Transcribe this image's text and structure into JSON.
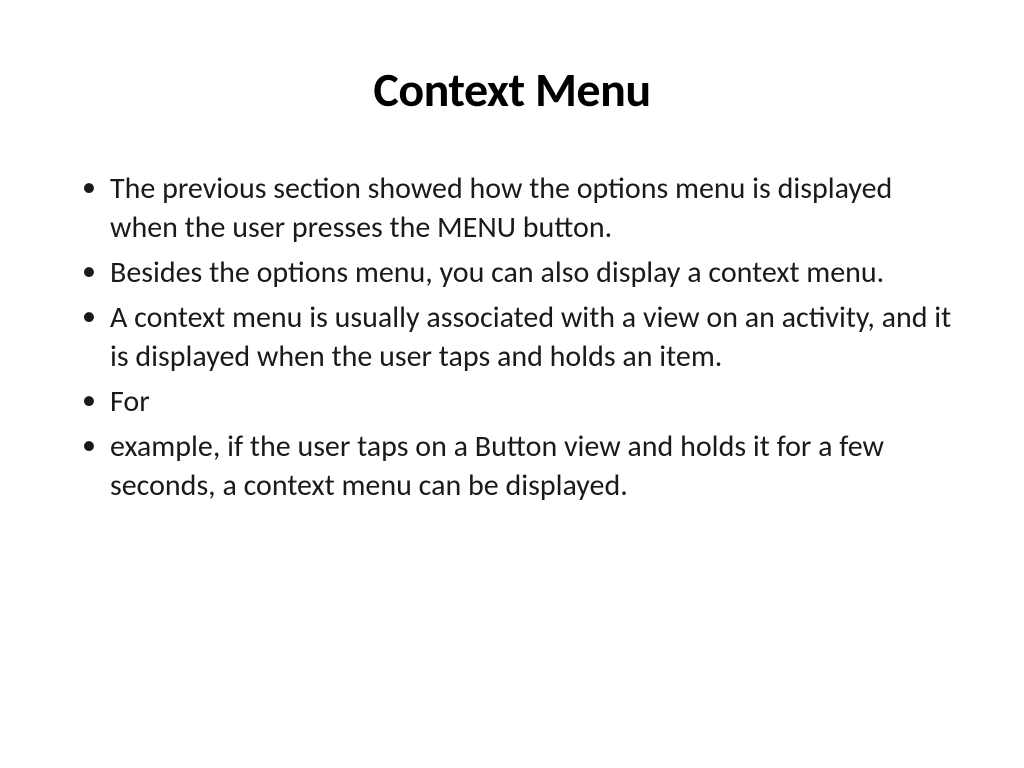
{
  "slide": {
    "title": "Context Menu",
    "bullets": [
      "The previous section showed how the options menu is displayed when the user presses the MENU button.",
      "Besides the options menu, you can also display a context menu.",
      "A context menu is usually associated with a view on an activity, and it is displayed when the user taps and holds an item.",
      "For",
      "example, if the user taps on a Button view and holds it for a few seconds, a context menu can be displayed."
    ]
  }
}
